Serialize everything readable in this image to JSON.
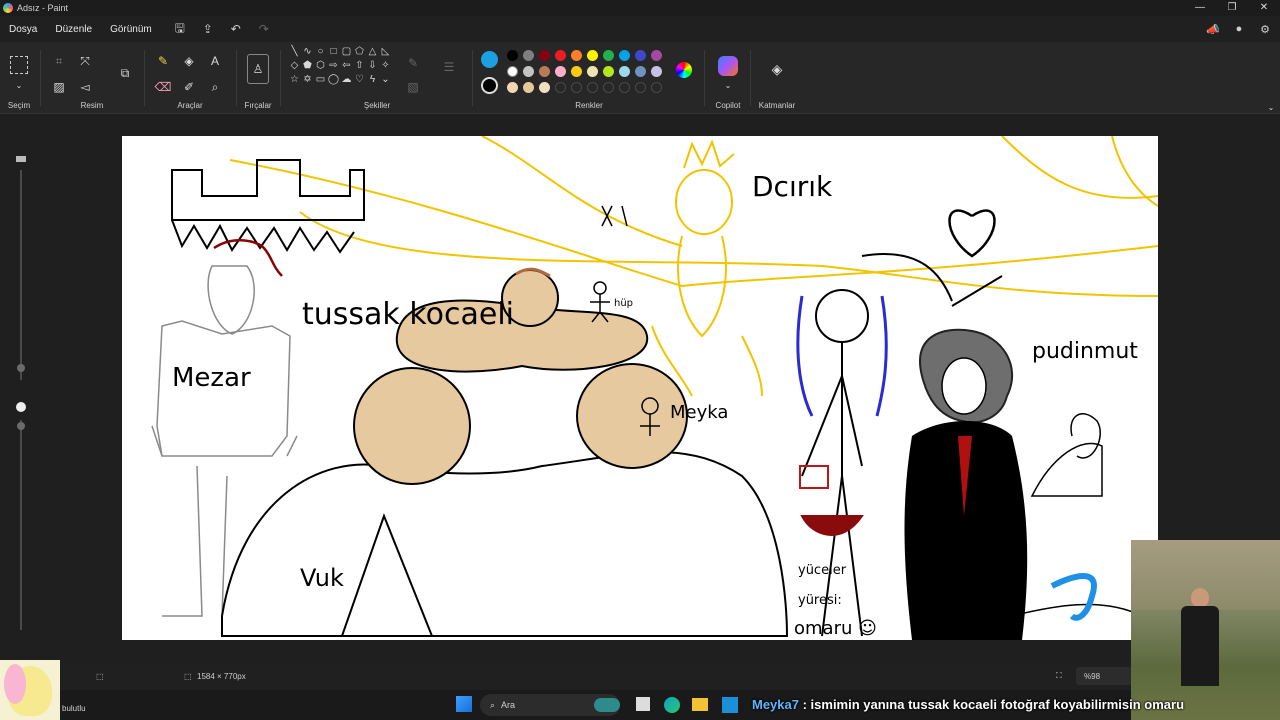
{
  "window": {
    "title": "Adsız - Paint"
  },
  "menu": {
    "file": "Dosya",
    "edit": "Düzenle",
    "view": "Görünüm"
  },
  "ribbon": {
    "selection": "Seçim",
    "image": "Resim",
    "tools": "Araçlar",
    "brushes": "Fırçalar",
    "shapes": "Şekiller",
    "colors": "Renkler",
    "copilot": "Copilot",
    "layers": "Katmanlar"
  },
  "colors": {
    "selected_primary": "#1ba1e2",
    "selected_secondary": "#000000",
    "row1": [
      "#000000",
      "#7f7f7f",
      "#880015",
      "#ed1c24",
      "#ff7f27",
      "#fff200",
      "#22b14c",
      "#00a2e8",
      "#3f48cc",
      "#a349a4"
    ],
    "row2": [
      "#ffffff",
      "#c3c3c3",
      "#b97a57",
      "#ffaec9",
      "#ffc90e",
      "#efe4b0",
      "#b5e61d",
      "#99d9ea",
      "#7092be",
      "#c8bfe7"
    ],
    "row3": [
      "#f5d6b0",
      "#e8c89a",
      "#f2dfc2"
    ]
  },
  "canvas_texts": {
    "dcirik": "Dcırık",
    "tussak": "tussak kocaeli",
    "mezar": "Mezar",
    "meyka": "Meyka",
    "hip": "hüp",
    "pudinmut": "pudinmut",
    "vuk": "Vuk",
    "yuceler": "yüceler",
    "yuresi": "yüresi:",
    "omaru": "omaru ☺"
  },
  "status": {
    "dimensions": "1584 × 770px",
    "zoom": "%98",
    "weather": "bulutlu"
  },
  "taskbar": {
    "search_placeholder": "Ara"
  },
  "chat": {
    "user": "Meyka7",
    "message": " : ismimin yanına tussak kocaeli fotoğraf koyabilirmisin omaru"
  }
}
